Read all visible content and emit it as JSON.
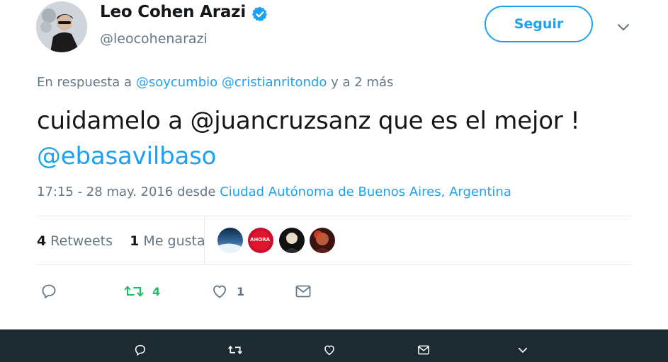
{
  "user": {
    "name": "Leo Cohen Arazi",
    "handle": "@leocohenarazi",
    "verified_icon": "verified-badge-icon"
  },
  "follow_button": {
    "label": "Seguir"
  },
  "reply": {
    "prefix": "En respuesta a",
    "mention1": "@soycumbio",
    "mention2": "@cristianritondo",
    "suffix": "y a 2 más"
  },
  "tweet": {
    "text_part1": "cuidamelo a @juancruzsanz que es el mejor !",
    "text_part2": "@ebasavilbaso"
  },
  "meta": {
    "timestamp": "17:15 - 28 may. 2016",
    "from": "desde",
    "location": "Ciudad Autónoma de Buenos Aires, Argentina"
  },
  "stats": {
    "retweets_count": "4",
    "retweets_label": "Retweets",
    "likes_count": "1",
    "likes_label": "Me gusta"
  },
  "likers": [
    {
      "icon": "avatar-1",
      "badge": ""
    },
    {
      "icon": "avatar-2",
      "badge": "AHORA"
    },
    {
      "icon": "avatar-3",
      "badge": ""
    },
    {
      "icon": "avatar-4",
      "badge": ""
    }
  ],
  "actions": {
    "reply_icon": "reply-icon",
    "retweet_icon": "retweet-icon",
    "retweet_count": "4",
    "like_icon": "heart-icon",
    "like_count": "1",
    "dm_icon": "envelope-icon"
  },
  "colors": {
    "accent": "#1da1f2",
    "retweet": "#17bf63",
    "muted": "#657786",
    "bottom_bar": "#1e2a32"
  }
}
